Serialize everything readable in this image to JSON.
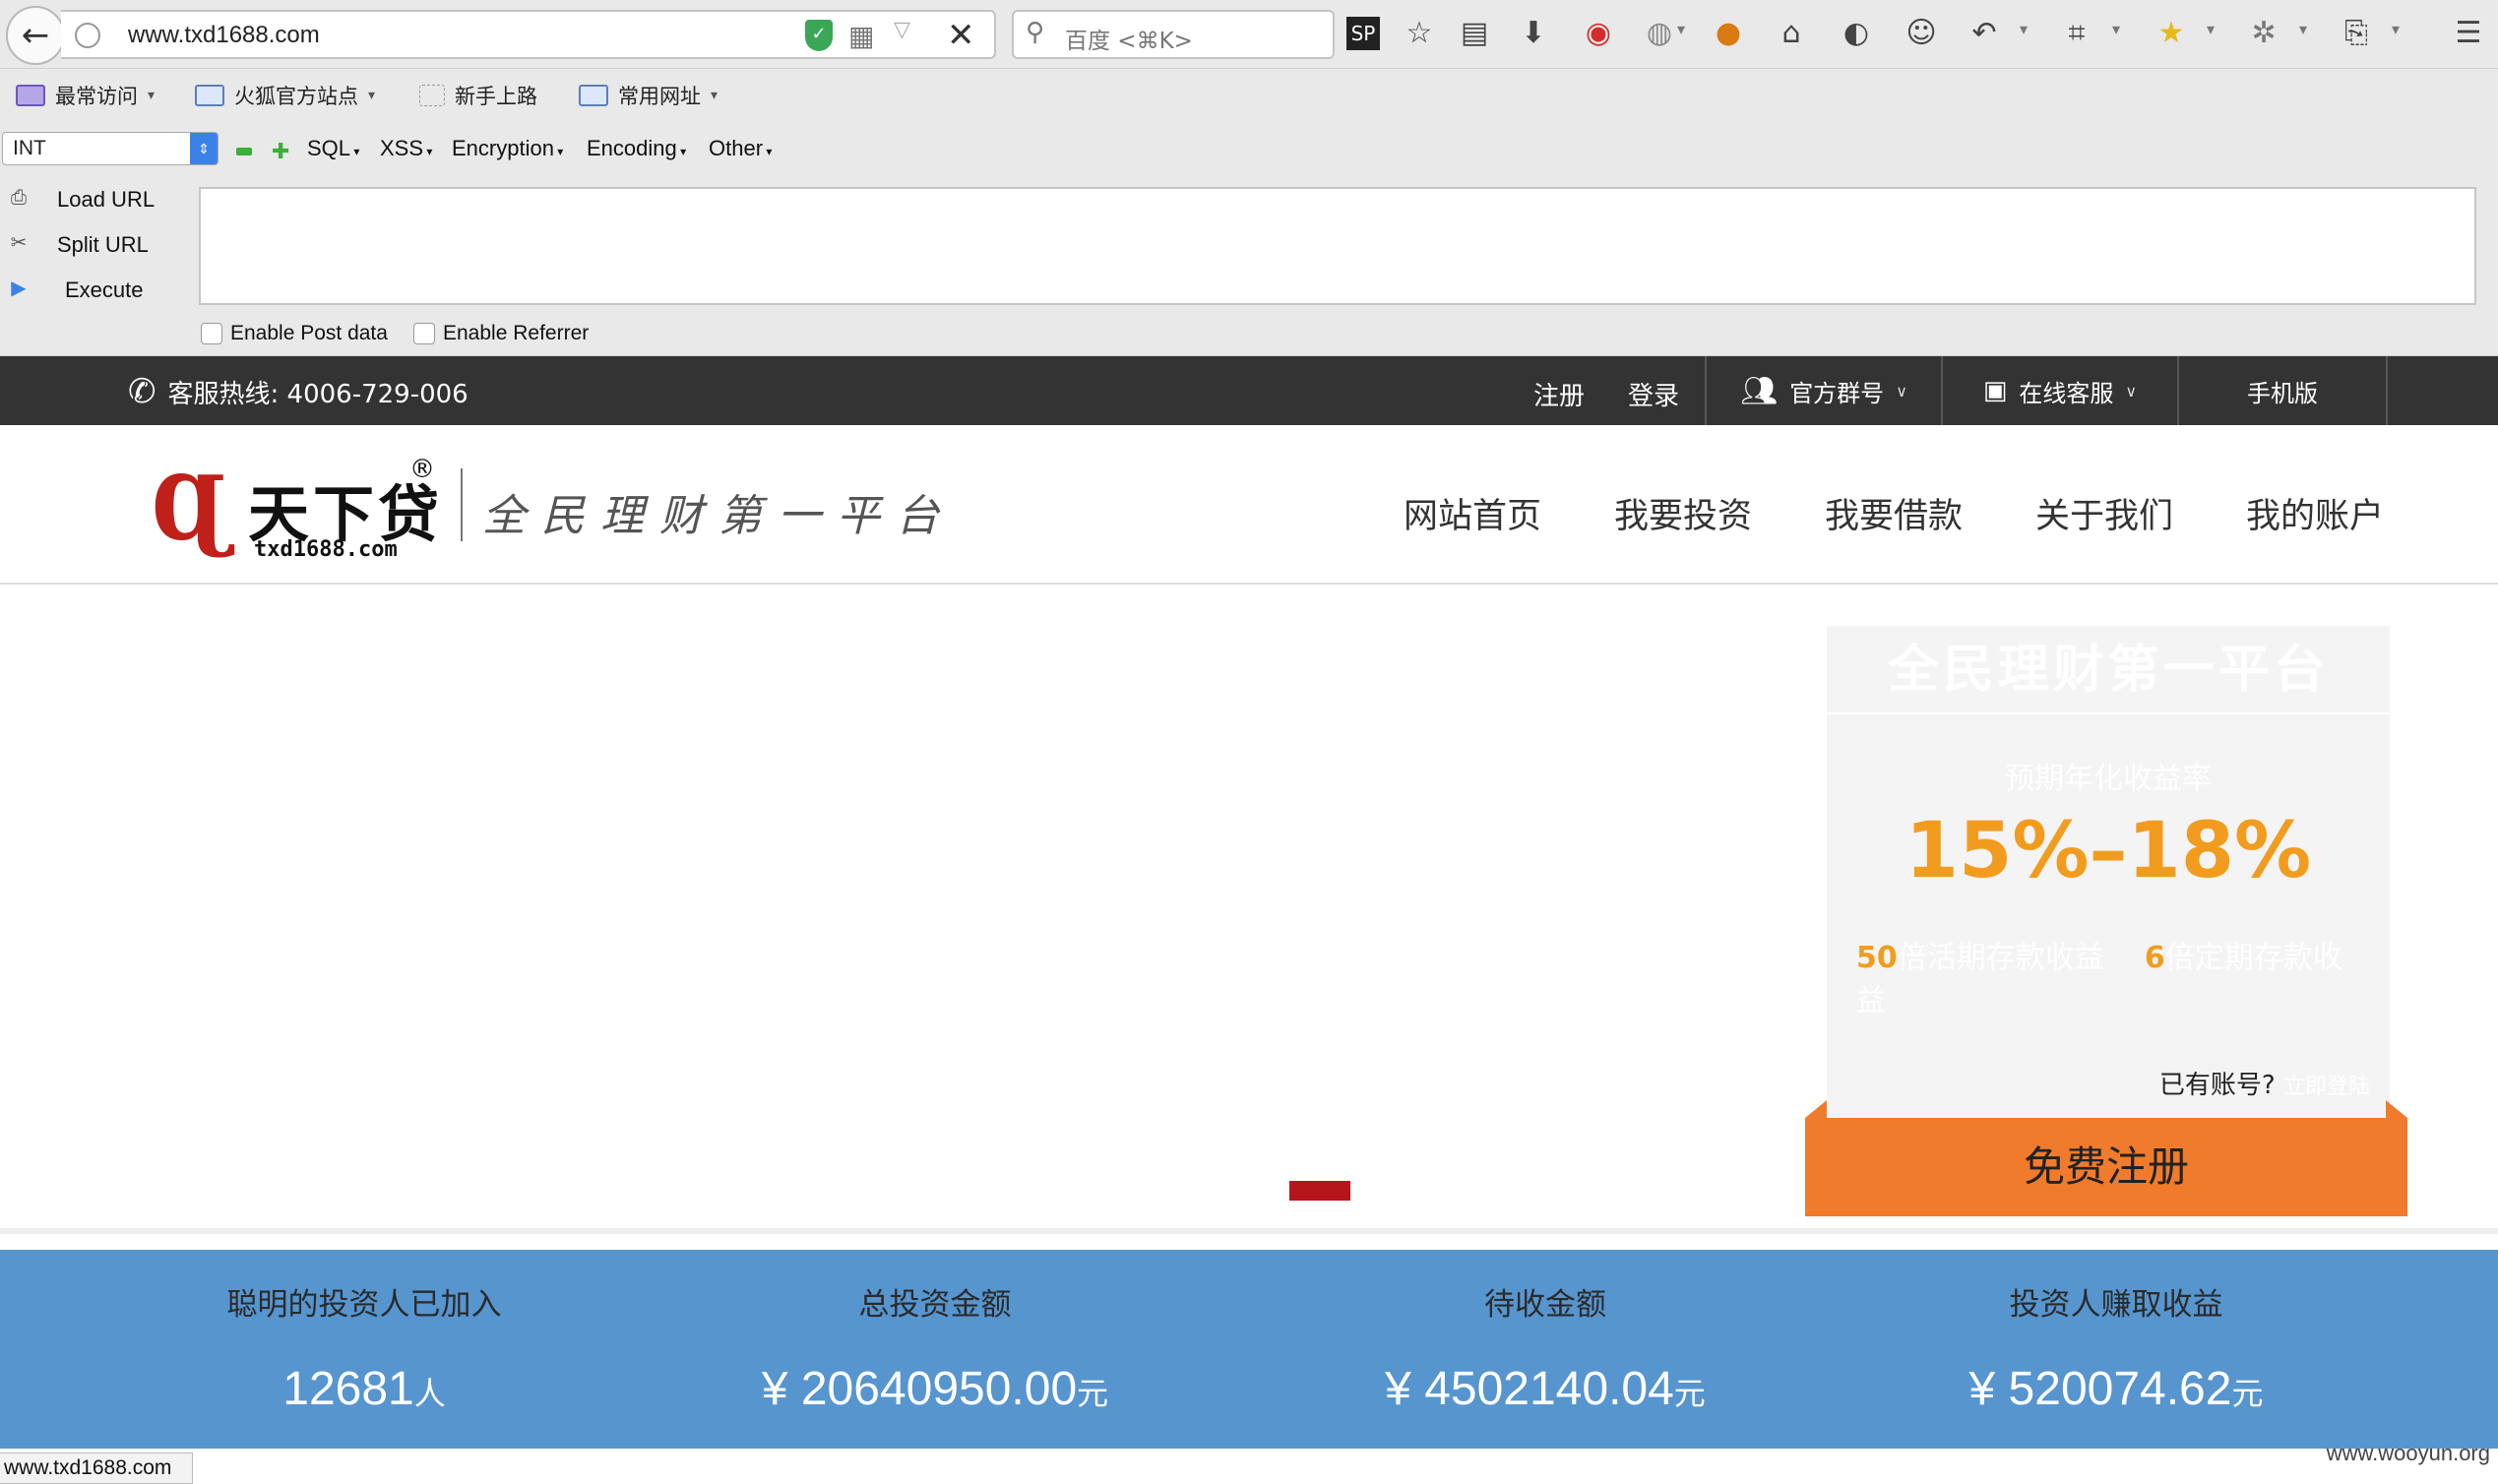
{
  "browser": {
    "url": "www.txd1688.com",
    "search_placeholder": "百度 <⌘K>",
    "bookmarks": [
      {
        "label": "最常访问"
      },
      {
        "label": "火狐官方站点"
      },
      {
        "label": "新手上路"
      },
      {
        "label": "常用网址"
      }
    ],
    "status_url": "www.txd1688.com"
  },
  "hackbar": {
    "select_value": "INT",
    "menus": {
      "sql": "SQL",
      "xss": "XSS",
      "encryption": "Encryption",
      "encoding": "Encoding",
      "other": "Other"
    },
    "actions": {
      "load": "Load URL",
      "split": "Split URL",
      "execute": "Execute"
    },
    "textarea_value": "",
    "enable_post": "Enable Post data",
    "enable_referrer": "Enable Referrer"
  },
  "topbar": {
    "hotline": "客服热线: 4006-729-006",
    "register": "注册",
    "login": "登录",
    "group": "官方群号",
    "service": "在线客服",
    "mobile": "手机版"
  },
  "header": {
    "logo_name": "天下贷",
    "logo_domain": "txd1688.com",
    "logo_reg": "®",
    "slogan": "全民理财第一平台",
    "nav": [
      "网站首页",
      "我要投资",
      "我要借款",
      "关于我们",
      "我的账户"
    ]
  },
  "promo": {
    "title": "全民理财第一平台",
    "subtitle": "预期年化收益率",
    "rate": "15%–18%",
    "mult1_num": "50",
    "mult1_text": "倍活期存款收益",
    "mult2_num": "6",
    "mult2_text": "倍定期存款收益",
    "has_account": "已有账号?",
    "login_now": "立即登陆",
    "register_button": "免费注册"
  },
  "stats": [
    {
      "label": "聪明的投资人已加入",
      "prefix": "",
      "value": "12681",
      "unit": "人"
    },
    {
      "label": "总投资金额",
      "prefix": "¥ ",
      "value": "20640950.00",
      "unit": "元"
    },
    {
      "label": "待收金额",
      "prefix": "¥ ",
      "value": "4502140.04",
      "unit": "元"
    },
    {
      "label": "投资人赚取收益",
      "prefix": "¥ ",
      "value": "520074.62",
      "unit": "元"
    }
  ],
  "watermark": "www.wooyun.org",
  "colors": {
    "topbar": "#333333",
    "stats_bg": "#5795cf",
    "accent_orange": "#f07b2c",
    "rate_orange": "#f29c1f",
    "logo_red": "#c0201a"
  }
}
